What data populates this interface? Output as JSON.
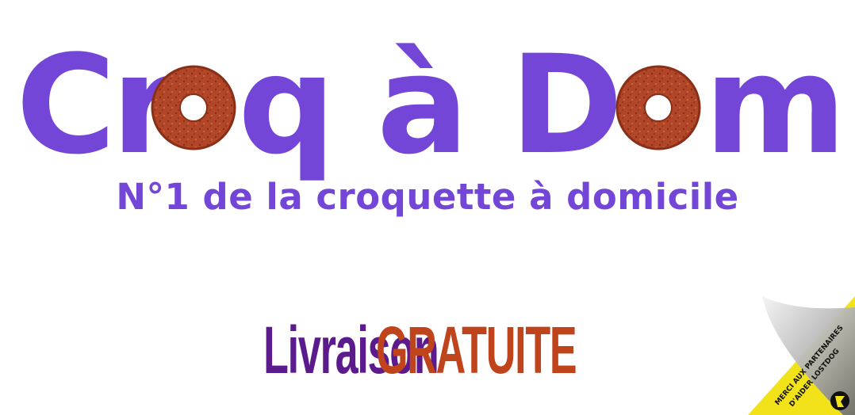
{
  "logo": {
    "text_part1": "Cr",
    "text_part2": "q à D",
    "text_part3": "m",
    "full_title": "Croq à Dom",
    "primary_color": "#7346d8",
    "kibble_color": "#b14628"
  },
  "tagline": "N°1 de la croquette à domicile",
  "delivery": {
    "word1": "Livraison",
    "word2": "GRATUITE"
  },
  "corner_sticker": {
    "line1": "MERCI AUX PARTENAIRES",
    "line2": "D'AIDER LOSTDOG",
    "icon": "lostdog-logo-icon"
  }
}
